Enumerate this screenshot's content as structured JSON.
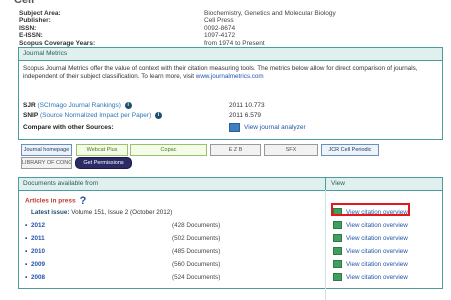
{
  "info": {
    "rows": [
      {
        "label": "Subject Area:",
        "value": "Biochemistry, Genetics and Molecular Biology"
      },
      {
        "label": "Publisher:",
        "value": "Cell Press"
      },
      {
        "label": "ISSN:",
        "value": "0092-8674"
      },
      {
        "label": "E-ISSN:",
        "value": "1097-4172"
      },
      {
        "label": "Scopus Coverage Years:",
        "value": "from 1974 to Present"
      }
    ]
  },
  "journal_metrics": {
    "title": "Journal Metrics",
    "description": "Scopus Journal Metrics offer the value of context with their citation measuring tools. The metrics below allow for direct comparison of journals, independent of their subject classification. To learn more, visit",
    "description_link": "www.journalmetrics.com",
    "sjr_label": "SJR",
    "sjr_sub": "(SCImago Journal Rankings)",
    "sjr_value": "2011  10.773",
    "snip_label": "SNIP",
    "snip_sub": "(Source Normalized Impact per Paper)",
    "snip_value": "2011  6.579",
    "compare_label": "Compare with other Sources:",
    "analyzer_label": "View journal analyzer"
  },
  "buttons": {
    "journal_homepage": "Journal homepage",
    "webcat": "Webcat Plus",
    "copac": "Copac",
    "ezb": "E Z B",
    "sfx": "SFX",
    "jcr": "JCR Cell Periodic",
    "library": "LIBRARY OF CONGRESS",
    "permissions": "Get Permissions"
  },
  "docs": {
    "header_docs": "Documents available from",
    "header_view": "View",
    "articles_in_press": "Articles in press",
    "latest_label": "Latest issue:",
    "latest_value": "Volume 151, Issue 2 (October 2012)",
    "highlighted_view": "View citation overview",
    "rows": [
      {
        "year": "2012",
        "count": "(428 Documents)",
        "view": "View citation overview"
      },
      {
        "year": "2011",
        "count": "(502 Documents)",
        "view": "View citation overview"
      },
      {
        "year": "2010",
        "count": "(485 Documents)",
        "view": "View citation overview"
      },
      {
        "year": "2009",
        "count": "(560 Documents)",
        "view": "View citation overview"
      },
      {
        "year": "2008",
        "count": "(524 Documents)",
        "view": "View citation overview"
      }
    ]
  }
}
